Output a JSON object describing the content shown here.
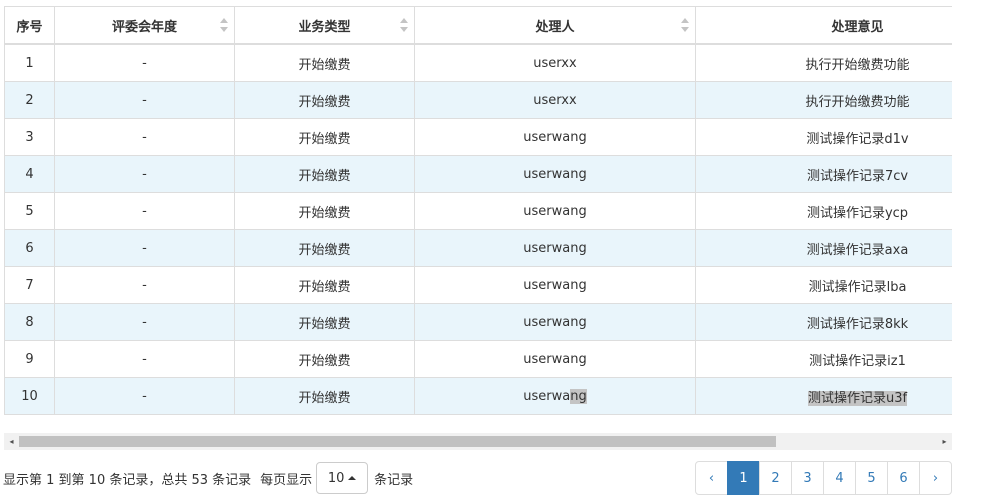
{
  "table": {
    "columns": [
      {
        "label": "序号",
        "sortable": false
      },
      {
        "label": "评委会年度",
        "sortable": true
      },
      {
        "label": "业务类型",
        "sortable": true
      },
      {
        "label": "处理人",
        "sortable": true
      },
      {
        "label": "处理意见",
        "sortable": false
      }
    ],
    "rows": [
      [
        "1",
        "-",
        "开始缴费",
        "userxx",
        "执行开始缴费功能"
      ],
      [
        "2",
        "-",
        "开始缴费",
        "userxx",
        "执行开始缴费功能"
      ],
      [
        "3",
        "-",
        "开始缴费",
        "userwang",
        "测试操作记录d1v"
      ],
      [
        "4",
        "-",
        "开始缴费",
        "userwang",
        "测试操作记录7cv"
      ],
      [
        "5",
        "-",
        "开始缴费",
        "userwang",
        "测试操作记录ycp"
      ],
      [
        "6",
        "-",
        "开始缴费",
        "userwang",
        "测试操作记录axa"
      ],
      [
        "7",
        "-",
        "开始缴费",
        "userwang",
        "测试操作记录lba"
      ],
      [
        "8",
        "-",
        "开始缴费",
        "userwang",
        "测试操作记录8kk"
      ],
      [
        "9",
        "-",
        "开始缴费",
        "userwang",
        "测试操作记录iz1"
      ],
      [
        "10",
        "-",
        "开始缴费",
        "userwang",
        "测试操作记录u3f"
      ]
    ]
  },
  "scrollbar": {
    "left_arrow": "◂",
    "right_arrow": "▸"
  },
  "pagination": {
    "info": "显示第 1 到第 10 条记录，总共 53 条记录",
    "per_page_prefix": "每页显示",
    "page_size": "10",
    "per_page_suffix": "条记录",
    "prev": "‹",
    "next": "›",
    "pages": [
      "1",
      "2",
      "3",
      "4",
      "5",
      "6"
    ],
    "current_page": "1"
  },
  "colors": {
    "accent": "#337ab7",
    "row_stripe": "#e9f5fb",
    "border": "#dddddd",
    "selection": "#c4c4c4"
  }
}
